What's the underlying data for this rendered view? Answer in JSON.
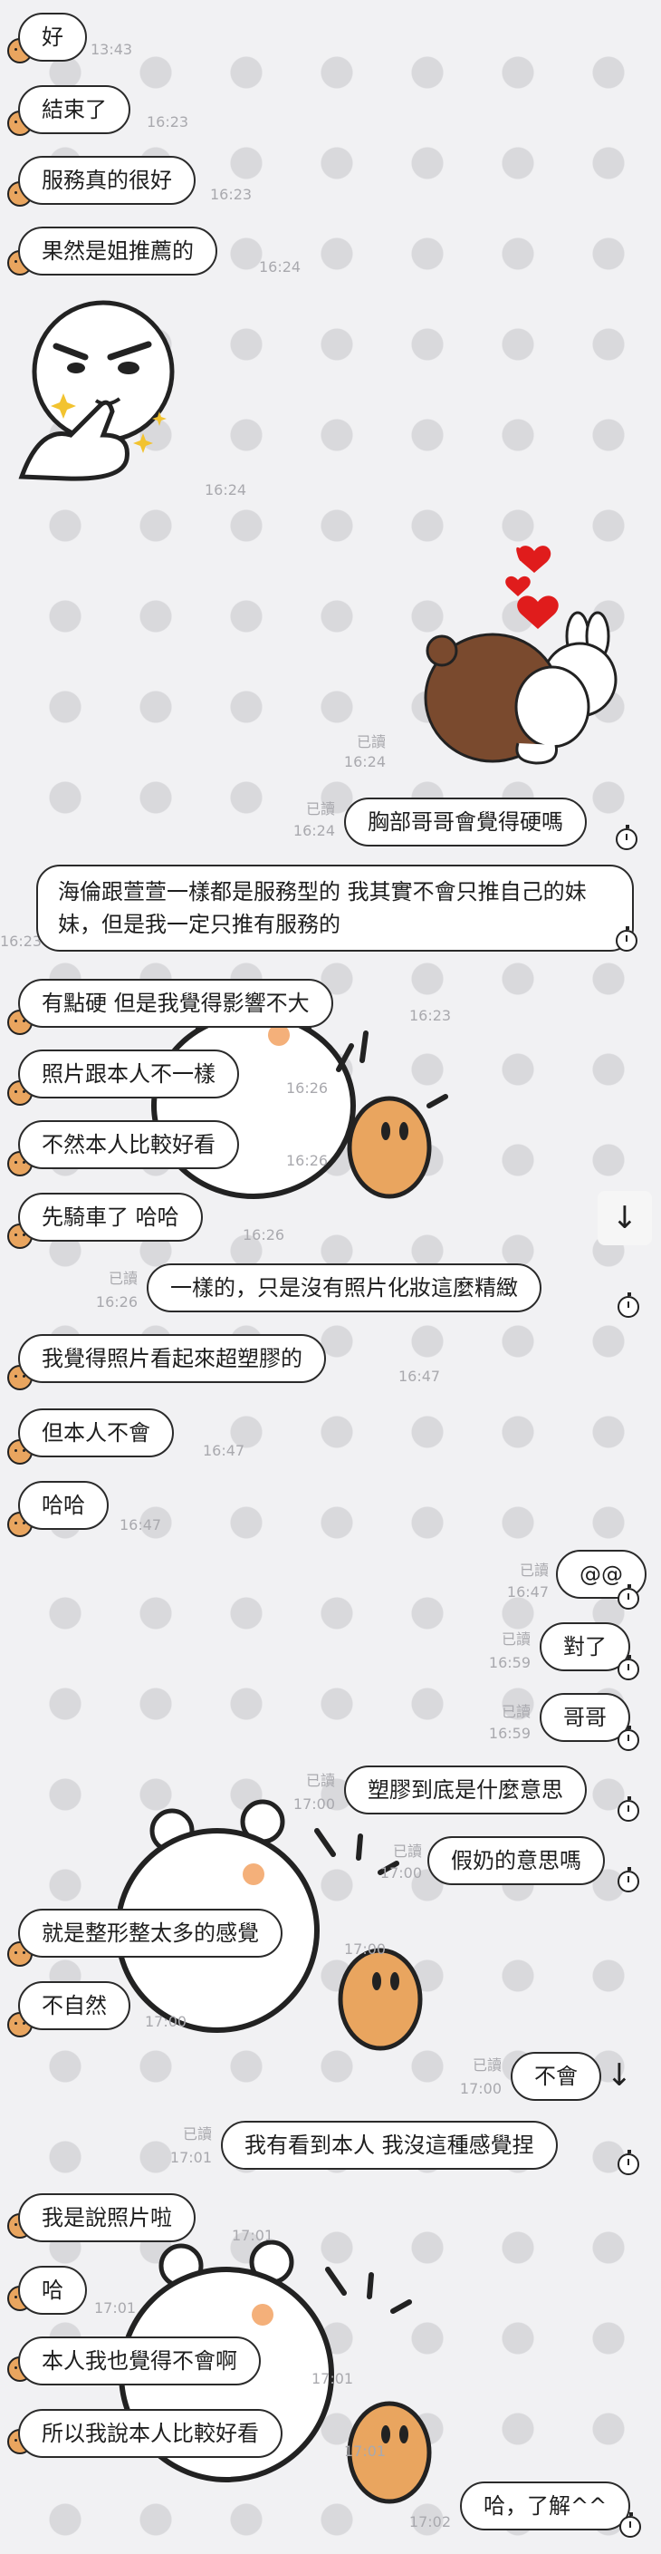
{
  "messages": [
    {
      "text": "好",
      "time": "13:43"
    },
    {
      "text": "結束了",
      "time": "16:23"
    },
    {
      "text": "服務真的很好",
      "time": "16:23"
    },
    {
      "text": "果然是姐推薦的",
      "time": "16:24"
    },
    {
      "sticker_time": "16:24"
    },
    {
      "read": "已讀",
      "time": "16:24"
    },
    {
      "read": "已讀",
      "time": "16:24",
      "text": "胸部哥哥會覺得硬嗎"
    },
    {
      "text": "海倫跟萱萱一樣都是服務型的 我其實不會只推自己的妹妹，但是我一定只推有服務的",
      "time": "16:23"
    },
    {
      "text": "有點硬 但是我覺得影響不大",
      "time": "16:23"
    },
    {
      "text": "照片跟本人不一樣",
      "time": "16:26"
    },
    {
      "text": "不然本人比較好看",
      "time": "16:26"
    },
    {
      "text": "先騎車了 哈哈",
      "time": "16:26"
    },
    {
      "read": "已讀",
      "time": "16:26",
      "text": "一樣的，只是沒有照片化妝這麼精緻"
    },
    {
      "text": "我覺得照片看起來超塑膠的",
      "time": "16:47"
    },
    {
      "text": "但本人不會",
      "time": "16:47"
    },
    {
      "text": "哈哈",
      "time": "16:47"
    },
    {
      "read": "已讀",
      "time": "16:47",
      "text": "@@"
    },
    {
      "read": "已讀",
      "time": "16:59",
      "text": "對了"
    },
    {
      "read": "已讀",
      "time": "16:59",
      "text": "哥哥"
    },
    {
      "read": "已讀",
      "time": "17:00",
      "text": "塑膠到底是什麼意思"
    },
    {
      "read": "已讀",
      "time": "17:00",
      "text": "假奶的意思嗎"
    },
    {
      "text": "就是整形整太多的感覺",
      "time": "17:00"
    },
    {
      "text": "不自然",
      "time": "17:00"
    },
    {
      "read": "已讀",
      "time": "17:00",
      "text": "不會"
    },
    {
      "read": "已讀",
      "time": "17:01",
      "text": "我有看到本人 我沒這種感覺捏"
    },
    {
      "text": "我是說照片啦",
      "time": "17:01"
    },
    {
      "text": "哈",
      "time": "17:01"
    },
    {
      "text": "本人我也覺得不會啊",
      "time": "17:01"
    },
    {
      "text": "所以我說本人比較好看",
      "time": "17:01"
    },
    {
      "time": "17:02",
      "text": "哈，了解^^"
    }
  ],
  "icons": {
    "avatar": "potato-avatar-icon",
    "stopwatch": "stopwatch-icon",
    "scroll_down": "arrow-down-icon"
  },
  "scroll_glyph": "↓",
  "colors": {
    "background": "#f1f1f3",
    "dots": "#d9d9dc",
    "bubble": "#ffffff",
    "avatar": "#e9a55f",
    "meta_text": "#a9a9ae"
  }
}
